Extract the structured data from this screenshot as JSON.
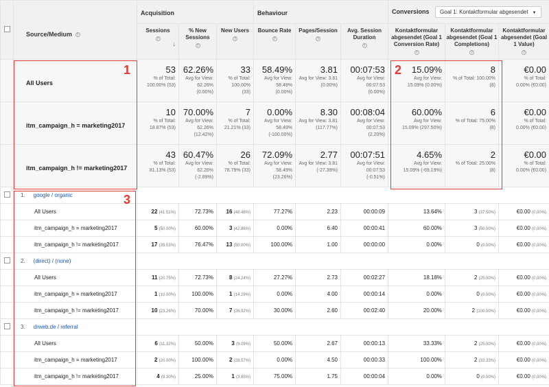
{
  "header": {
    "source_medium": "Source/Medium",
    "acquisition": "Acquisition",
    "behaviour": "Behaviour",
    "conversions": "Conversions",
    "goal_select": "Goal 1: Kontaktformular abgesendet",
    "help_glyph": "?",
    "sort_arrow": "↓",
    "caret": "▼",
    "columns": [
      "Sessions",
      "% New Sessions",
      "New Users",
      "Bounce Rate",
      "Pages/Session",
      "Avg. Session Duration",
      "Kontaktformular abgesendet (Goal 1 Conversion Rate)",
      "Kontaktformular abgesendet (Goal 1 Completions)",
      "Kontaktformular abgesendet (Goal 1 Value)"
    ]
  },
  "totals": [
    {
      "segment": "All Users",
      "cells": [
        {
          "v": "53",
          "s1": "% of Total:",
          "s2": "100.00% (53)",
          "s3": ""
        },
        {
          "v": "62.26%",
          "s1": "Avg for View:",
          "s2": "62.26%",
          "s3": "(0.00%)"
        },
        {
          "v": "33",
          "s1": "% of Total:",
          "s2": "100.00%",
          "s3": "(33)"
        },
        {
          "v": "58.49%",
          "s1": "Avg for View:",
          "s2": "58.49%",
          "s3": "(0.00%)"
        },
        {
          "v": "3.81",
          "s1": "Avg for View: 3.81",
          "s2": "(0.00%)",
          "s3": ""
        },
        {
          "v": "00:07:53",
          "s1": "Avg for View:",
          "s2": "00:07:53",
          "s3": "(0.00%)"
        },
        {
          "v": "15.09%",
          "s1": "Avg for View:",
          "s2": "15.09% (0.00%)",
          "s3": ""
        },
        {
          "v": "8",
          "s1": "% of Total: 100.00%",
          "s2": "(8)",
          "s3": ""
        },
        {
          "v": "€0.00",
          "s1": "% of Total:",
          "s2": "0.00% (€0.00)",
          "s3": ""
        }
      ]
    },
    {
      "segment": "itm_campaign_h = marketing2017",
      "cells": [
        {
          "v": "10",
          "s1": "% of Total:",
          "s2": "18.87% (53)",
          "s3": ""
        },
        {
          "v": "70.00%",
          "s1": "Avg for View:",
          "s2": "62.26%",
          "s3": "(12.42%)"
        },
        {
          "v": "7",
          "s1": "% of Total:",
          "s2": "21.21% (33)",
          "s3": ""
        },
        {
          "v": "0.00%",
          "s1": "Avg for View:",
          "s2": "58.49%",
          "s3": "(-100.00%)"
        },
        {
          "v": "8.30",
          "s1": "Avg for View: 3.81",
          "s2": "(117.77%)",
          "s3": ""
        },
        {
          "v": "00:08:04",
          "s1": "Avg for View:",
          "s2": "00:07:53",
          "s3": "(2.20%)"
        },
        {
          "v": "60.00%",
          "s1": "Avg for View:",
          "s2": "15.09% (297.50%)",
          "s3": ""
        },
        {
          "v": "6",
          "s1": "% of Total: 75.00%",
          "s2": "(8)",
          "s3": ""
        },
        {
          "v": "€0.00",
          "s1": "% of Total:",
          "s2": "0.00% (€0.00)",
          "s3": ""
        }
      ]
    },
    {
      "segment": "itm_campaign_h != marketing2017",
      "cells": [
        {
          "v": "43",
          "s1": "% of Total:",
          "s2": "81.13% (53)",
          "s3": ""
        },
        {
          "v": "60.47%",
          "s1": "Avg for View:",
          "s2": "62.26%",
          "s3": "(-2.89%)"
        },
        {
          "v": "26",
          "s1": "% of Total:",
          "s2": "78.79% (33)",
          "s3": ""
        },
        {
          "v": "72.09%",
          "s1": "Avg for View:",
          "s2": "58.49%",
          "s3": "(23.26%)"
        },
        {
          "v": "2.77",
          "s1": "Avg for View: 3.81",
          "s2": "(-27.39%)",
          "s3": ""
        },
        {
          "v": "00:07:51",
          "s1": "Avg for View:",
          "s2": "00:07:53",
          "s3": "(-0.51%)"
        },
        {
          "v": "4.65%",
          "s1": "Avg for View:",
          "s2": "15.09% (-69.19%)",
          "s3": ""
        },
        {
          "v": "2",
          "s1": "% of Total: 25.00%",
          "s2": "(8)",
          "s3": ""
        },
        {
          "v": "€0.00",
          "s1": "% of Total:",
          "s2": "0.00% (€0.00)",
          "s3": ""
        }
      ]
    }
  ],
  "groups": [
    {
      "num": "1.",
      "name": "google / organic",
      "rows": [
        {
          "segment": "All Users",
          "sessions": "22",
          "sessions_pct": "(41.51%)",
          "new_sess": "72.73%",
          "new_users": "16",
          "new_users_pct": "(48.48%)",
          "bounce": "77.27%",
          "pages": "2.23",
          "dur": "00:00:09",
          "conv": "13.64%",
          "compl": "3",
          "compl_pct": "(37.50%)",
          "value": "€0.00",
          "value_pct": "(0.00%)"
        },
        {
          "segment": "itm_campaign_h = marketing2017",
          "sessions": "5",
          "sessions_pct": "(50.00%)",
          "new_sess": "60.00%",
          "new_users": "3",
          "new_users_pct": "(42.86%)",
          "bounce": "0.00%",
          "pages": "6.40",
          "dur": "00:00:41",
          "conv": "60.00%",
          "compl": "3",
          "compl_pct": "(50.00%)",
          "value": "€0.00",
          "value_pct": "(0.00%)"
        },
        {
          "segment": "itm_campaign_h != marketing2017",
          "sessions": "17",
          "sessions_pct": "(39.53%)",
          "new_sess": "76.47%",
          "new_users": "13",
          "new_users_pct": "(50.00%)",
          "bounce": "100.00%",
          "pages": "1.00",
          "dur": "00:00:00",
          "conv": "0.00%",
          "compl": "0",
          "compl_pct": "(0.00%)",
          "value": "€0.00",
          "value_pct": "(0.00%)"
        }
      ]
    },
    {
      "num": "2.",
      "name": "(direct) / (none)",
      "rows": [
        {
          "segment": "All Users",
          "sessions": "11",
          "sessions_pct": "(20.75%)",
          "new_sess": "72.73%",
          "new_users": "8",
          "new_users_pct": "(24.24%)",
          "bounce": "27.27%",
          "pages": "2.73",
          "dur": "00:02:27",
          "conv": "18.18%",
          "compl": "2",
          "compl_pct": "(25.00%)",
          "value": "€0.00",
          "value_pct": "(0.00%)"
        },
        {
          "segment": "itm_campaign_h = marketing2017",
          "sessions": "1",
          "sessions_pct": "(10.00%)",
          "new_sess": "100.00%",
          "new_users": "1",
          "new_users_pct": "(14.29%)",
          "bounce": "0.00%",
          "pages": "4.00",
          "dur": "00:00:14",
          "conv": "0.00%",
          "compl": "0",
          "compl_pct": "(0.00%)",
          "value": "€0.00",
          "value_pct": "(0.00%)"
        },
        {
          "segment": "itm_campaign_h != marketing2017",
          "sessions": "10",
          "sessions_pct": "(23.26%)",
          "new_sess": "70.00%",
          "new_users": "7",
          "new_users_pct": "(26.92%)",
          "bounce": "30.00%",
          "pages": "2.60",
          "dur": "00:02:40",
          "conv": "20.00%",
          "compl": "2",
          "compl_pct": "(100.00%)",
          "value": "€0.00",
          "value_pct": "(0.00%)"
        }
      ]
    },
    {
      "num": "3.",
      "name": "drweb.de / referral",
      "rows": [
        {
          "segment": "All Users",
          "sessions": "6",
          "sessions_pct": "(11.32%)",
          "new_sess": "50.00%",
          "new_users": "3",
          "new_users_pct": "(9.09%)",
          "bounce": "50.00%",
          "pages": "2.67",
          "dur": "00:00:13",
          "conv": "33.33%",
          "compl": "2",
          "compl_pct": "(25.00%)",
          "value": "€0.00",
          "value_pct": "(0.00%)"
        },
        {
          "segment": "itm_campaign_h = marketing2017",
          "sessions": "2",
          "sessions_pct": "(20.00%)",
          "new_sess": "100.00%",
          "new_users": "2",
          "new_users_pct": "(28.57%)",
          "bounce": "0.00%",
          "pages": "4.50",
          "dur": "00:00:33",
          "conv": "100.00%",
          "compl": "2",
          "compl_pct": "(33.33%)",
          "value": "€0.00",
          "value_pct": "(0.00%)"
        },
        {
          "segment": "itm_campaign_h != marketing2017",
          "sessions": "4",
          "sessions_pct": "(9.30%)",
          "new_sess": "25.00%",
          "new_users": "1",
          "new_users_pct": "(3.85%)",
          "bounce": "75.00%",
          "pages": "1.75",
          "dur": "00:00:04",
          "conv": "0.00%",
          "compl": "0",
          "compl_pct": "(0.00%)",
          "value": "€0.00",
          "value_pct": "(0.00%)"
        }
      ]
    }
  ],
  "annotations": {
    "box1": "1",
    "box2": "2",
    "box3": "3",
    "color": "#e53935"
  }
}
